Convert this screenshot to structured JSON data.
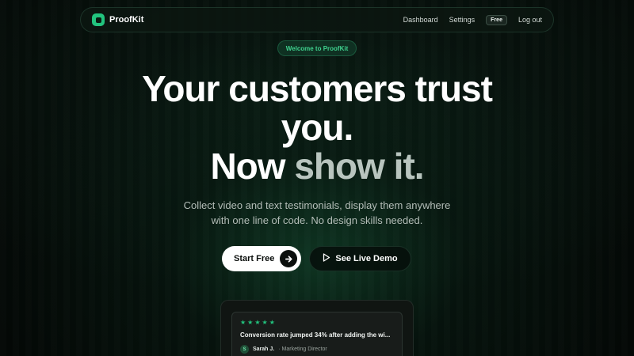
{
  "brand": {
    "name": "ProofKit"
  },
  "nav": {
    "links": [
      "Dashboard",
      "Settings"
    ],
    "plan_badge": "Free",
    "logout": "Log out"
  },
  "hero": {
    "pill": "Welcome to ProofKit",
    "headline_line1": "Your customers trust",
    "headline_line2": "you.",
    "headline_line3_a": "Now",
    "headline_line3_b": "show it.",
    "subtitle_line1": "Collect video and text testimonials, display them anywhere",
    "subtitle_line2": "with one line of code. No design skills needed."
  },
  "cta": {
    "primary": "Start Free",
    "secondary": "See Live Demo"
  },
  "testimonial": {
    "rating": 5,
    "stars": [
      "★",
      "★",
      "★",
      "★",
      "★"
    ],
    "quote": "Conversion rate jumped 34% after adding the wi...",
    "avatar_initial": "S",
    "author": "Sarah J.",
    "role": "· Marketing Director"
  },
  "colors": {
    "accent": "#22c37e",
    "background": "#040806",
    "pill_text": "#3fd28f"
  },
  "icons": {
    "logo": "rounded-square-logo-icon",
    "primary_cta": "arrow-right-icon",
    "secondary_cta": "play-icon",
    "rating": "star-icon"
  }
}
